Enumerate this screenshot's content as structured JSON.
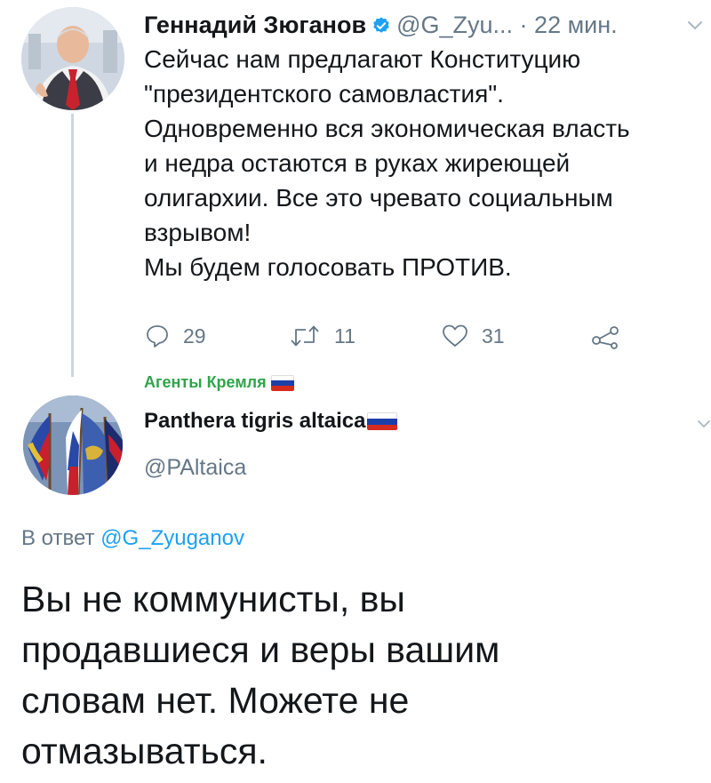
{
  "tweet": {
    "author_name": "Геннадий Зюганов",
    "author_handle": "@G_Zyu...",
    "separator": "·",
    "time": "22 мин.",
    "verified_icon": "verified-badge-icon",
    "text_lines": [
      "Сейчас нам предлагают Конституцию",
      "\"президентского самовластия\".",
      "Одновременно вся экономическая власть",
      "и недра остаются в руках жиреющей",
      "олигархии. Все это чревато социальным",
      "взрывом!",
      "Мы будем голосовать ПРОТИВ."
    ],
    "actions": {
      "replies": "29",
      "retweets": "11",
      "likes": "31"
    }
  },
  "group_label": "Агенты Кремля",
  "reply": {
    "author_name": "Panthera tigris altaica",
    "author_handle": "@PAltaica",
    "reply_to_prefix": "В ответ",
    "reply_to_mention": "@G_Zyuganov",
    "text_lines": [
      "Вы не коммунисты, вы",
      "продавшиеся и веры вашим",
      "словам нет. Можете не",
      "отмазываться."
    ]
  },
  "colors": {
    "accent": "#1da1f2",
    "secondary_text": "#657786",
    "group_label": "#2fa54b",
    "thread_line": "#ccd6dd"
  }
}
